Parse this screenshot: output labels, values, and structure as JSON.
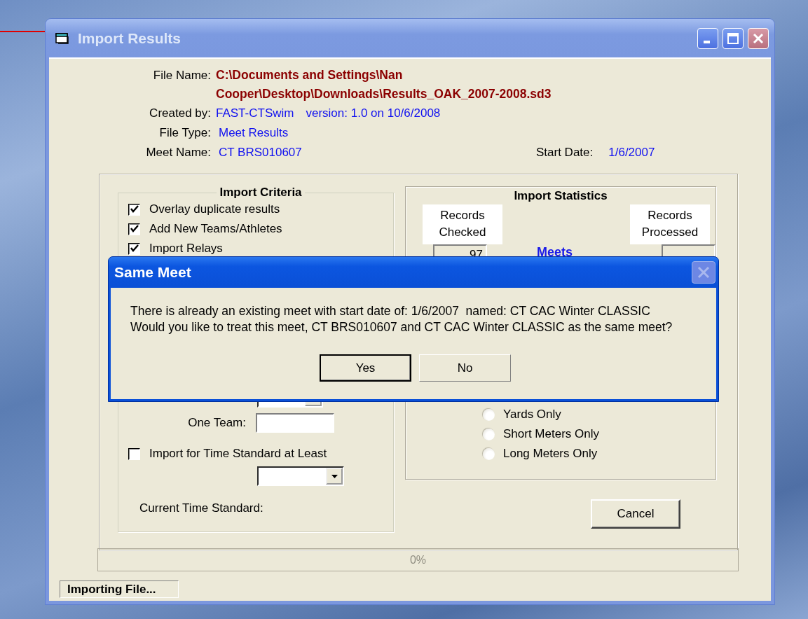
{
  "window": {
    "title": "Import Results"
  },
  "file_info": {
    "file_name_label": "File Name:",
    "file_name_lines": [
      "C:\\Documents and Settings\\Nan",
      "Cooper\\Desktop\\Downloads\\Results_OAK_2007-2008.sd3"
    ],
    "created_by_label": "Created by:",
    "created_by": "FAST-CTSwim",
    "version": "version: 1.0 on 10/6/2008",
    "file_type_label": "File Type:",
    "file_type": "Meet Results",
    "meet_name_label": "Meet Name:",
    "meet_name": "CT BRS010607",
    "start_date_label": "Start Date:",
    "start_date": "1/6/2007"
  },
  "criteria": {
    "title": "Import Criteria",
    "options": [
      {
        "label": "Overlay duplicate results",
        "checked": true
      },
      {
        "label": "Add New Teams/Athletes",
        "checked": true
      },
      {
        "label": "Import Relays",
        "checked": true
      }
    ],
    "one_team_label": "One Team:",
    "time_standard": {
      "label": "Import for Time Standard at Least",
      "checked": false
    },
    "current_time_standard_label": "Current Time Standard:"
  },
  "statistics": {
    "title": "Import Statistics",
    "records_checked_label": "Records Checked",
    "records_processed_label": "Records Processed",
    "records_checked": "97",
    "row_label": "Meets",
    "courses": [
      {
        "label": "Yards Only",
        "selected": false
      },
      {
        "label": "Short Meters Only",
        "selected": false
      },
      {
        "label": "Long Meters Only",
        "selected": false
      }
    ]
  },
  "cancel_button": "Cancel",
  "progress": {
    "level": 0,
    "label": "0%"
  },
  "status_bar": "Importing File...",
  "dialog": {
    "title": "Same Meet",
    "lines": [
      "There is already an existing meet with start date of: 1/6/2007  named: CT CAC Winter CLASSIC",
      "Would you like to treat this meet, CT BRS010607 and CT CAC Winter CLASSIC as the same meet?"
    ],
    "buttons": [
      {
        "label": "Yes",
        "default": true
      },
      {
        "label": "No",
        "default": false
      }
    ]
  }
}
